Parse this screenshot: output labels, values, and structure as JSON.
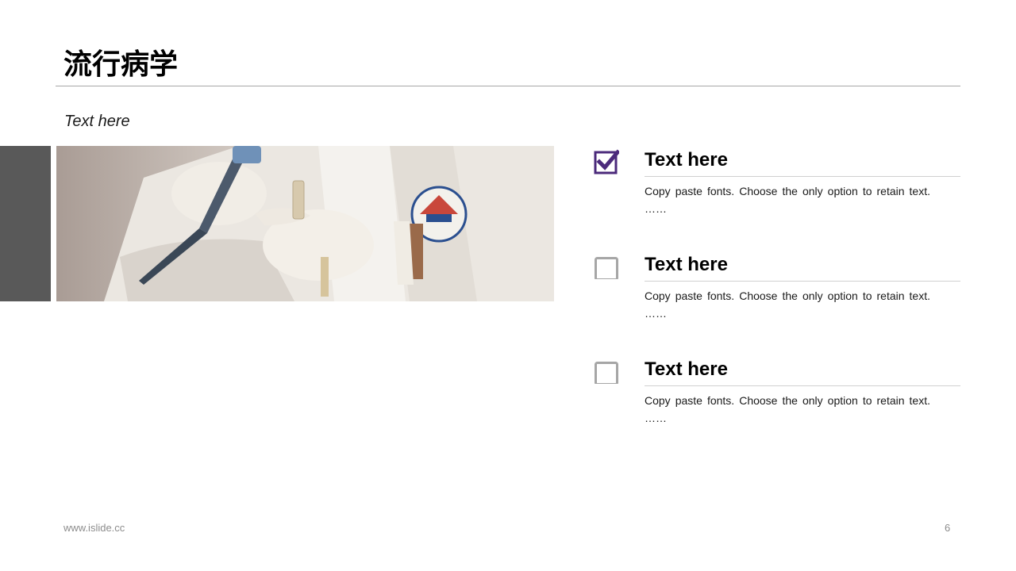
{
  "slide": {
    "title": "流行病学",
    "subtitle": "Text here",
    "items": [
      {
        "heading": "Text here",
        "description": "Copy paste fonts. Choose the only option to retain text.",
        "ellipsis": "……",
        "checked": true
      },
      {
        "heading": "Text here",
        "description": "Copy paste fonts. Choose the only option to retain text.",
        "ellipsis": "……",
        "checked": false
      },
      {
        "heading": "Text here",
        "description": "Copy paste fonts. Choose the only option to retain text.",
        "ellipsis": "……",
        "checked": false
      }
    ]
  },
  "footer": {
    "url": "www.islide.cc",
    "page_number": "6"
  },
  "colors": {
    "accent": "#4b2a7b",
    "unchecked": "#a6a6a6",
    "side_bar": "#595959"
  },
  "icons": {
    "checked": "checkbox-checked-icon",
    "unchecked": "checkbox-empty-icon"
  }
}
